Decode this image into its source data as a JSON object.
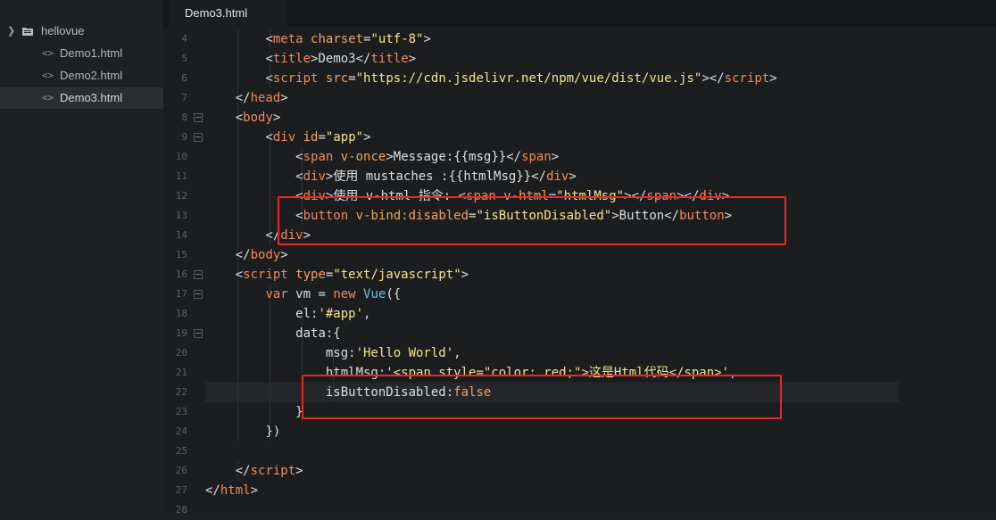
{
  "sidebar": {
    "folder": "hellovue",
    "files": [
      "Demo1.html",
      "Demo2.html",
      "Demo3.html"
    ],
    "active_index": 2
  },
  "tab": {
    "title": "Demo3.html"
  },
  "icons": {
    "folder": "folder-icon",
    "file": "code-file-icon",
    "fold": "fold-toggle-icon"
  },
  "colors": {
    "annotation": "#e8262c",
    "tag": "#f08a5d",
    "string": "#f5e48a",
    "attribute": "#f3a35c",
    "function": "#63c1e8"
  },
  "lines": [
    {
      "n": "4",
      "fold": false,
      "tokens": [
        [
          "sp",
          "        "
        ],
        [
          "pun",
          "<"
        ],
        [
          "tag",
          "meta"
        ],
        [
          "sp",
          " "
        ],
        [
          "attr",
          "charset"
        ],
        [
          "pun",
          "="
        ],
        [
          "str",
          "\"utf-8\""
        ],
        [
          "pun",
          ">"
        ]
      ]
    },
    {
      "n": "5",
      "fold": false,
      "tokens": [
        [
          "sp",
          "        "
        ],
        [
          "pun",
          "<"
        ],
        [
          "tag",
          "title"
        ],
        [
          "pun",
          ">"
        ],
        [
          "txt",
          "Demo3"
        ],
        [
          "pun",
          "</"
        ],
        [
          "tag",
          "title"
        ],
        [
          "pun",
          ">"
        ]
      ]
    },
    {
      "n": "6",
      "fold": false,
      "tokens": [
        [
          "sp",
          "        "
        ],
        [
          "pun",
          "<"
        ],
        [
          "tag",
          "script"
        ],
        [
          "sp",
          " "
        ],
        [
          "attr",
          "src"
        ],
        [
          "pun",
          "="
        ],
        [
          "str",
          "\"https://cdn.jsdelivr.net/npm/vue/dist/vue.js\""
        ],
        [
          "pun",
          "></"
        ],
        [
          "tag",
          "script"
        ],
        [
          "pun",
          ">"
        ]
      ]
    },
    {
      "n": "7",
      "fold": false,
      "tokens": [
        [
          "sp",
          "    "
        ],
        [
          "pun",
          "</"
        ],
        [
          "tag",
          "head"
        ],
        [
          "pun",
          ">"
        ]
      ]
    },
    {
      "n": "8",
      "fold": true,
      "tokens": [
        [
          "sp",
          "    "
        ],
        [
          "pun",
          "<"
        ],
        [
          "tag",
          "body"
        ],
        [
          "pun",
          ">"
        ]
      ]
    },
    {
      "n": "9",
      "fold": true,
      "tokens": [
        [
          "sp",
          "        "
        ],
        [
          "pun",
          "<"
        ],
        [
          "tag",
          "div"
        ],
        [
          "sp",
          " "
        ],
        [
          "attr",
          "id"
        ],
        [
          "pun",
          "="
        ],
        [
          "str",
          "\"app\""
        ],
        [
          "pun",
          ">"
        ]
      ]
    },
    {
      "n": "10",
      "fold": false,
      "tokens": [
        [
          "sp",
          "            "
        ],
        [
          "pun",
          "<"
        ],
        [
          "tag",
          "span"
        ],
        [
          "sp",
          " "
        ],
        [
          "attr",
          "v-once"
        ],
        [
          "pun",
          ">"
        ],
        [
          "txt",
          "Message:{{msg}}"
        ],
        [
          "pun",
          "</"
        ],
        [
          "tag",
          "span"
        ],
        [
          "pun",
          ">"
        ]
      ]
    },
    {
      "n": "11",
      "fold": false,
      "tokens": [
        [
          "sp",
          "            "
        ],
        [
          "pun",
          "<"
        ],
        [
          "tag",
          "div"
        ],
        [
          "pun",
          ">"
        ],
        [
          "txt",
          "使用 mustaches :{{htmlMsg}}"
        ],
        [
          "pun",
          "</"
        ],
        [
          "tag",
          "div"
        ],
        [
          "pun",
          ">"
        ]
      ]
    },
    {
      "n": "12",
      "fold": false,
      "tokens": [
        [
          "sp",
          "            "
        ],
        [
          "pun",
          "<"
        ],
        [
          "tag",
          "div"
        ],
        [
          "pun",
          ">"
        ],
        [
          "txt",
          "使用 v-html 指令: "
        ],
        [
          "pun",
          "<"
        ],
        [
          "tag",
          "span"
        ],
        [
          "sp",
          " "
        ],
        [
          "attr",
          "v-html"
        ],
        [
          "pun",
          "="
        ],
        [
          "str",
          "\"htmlMsg\""
        ],
        [
          "pun",
          "></"
        ],
        [
          "tag",
          "span"
        ],
        [
          "pun",
          "></"
        ],
        [
          "tag",
          "div"
        ],
        [
          "pun",
          ">"
        ]
      ]
    },
    {
      "n": "13",
      "fold": false,
      "tokens": [
        [
          "sp",
          "            "
        ],
        [
          "pun",
          "<"
        ],
        [
          "tag",
          "button"
        ],
        [
          "sp",
          " "
        ],
        [
          "attr",
          "v-bind:disabled"
        ],
        [
          "pun",
          "="
        ],
        [
          "str",
          "\"isButtonDisabled\""
        ],
        [
          "pun",
          ">"
        ],
        [
          "txt",
          "Button"
        ],
        [
          "pun",
          "</"
        ],
        [
          "tag",
          "button"
        ],
        [
          "pun",
          ">"
        ]
      ]
    },
    {
      "n": "14",
      "fold": false,
      "tokens": [
        [
          "sp",
          "        "
        ],
        [
          "pun",
          "</"
        ],
        [
          "tag",
          "div"
        ],
        [
          "pun",
          ">"
        ]
      ]
    },
    {
      "n": "15",
      "fold": false,
      "tokens": [
        [
          "sp",
          "    "
        ],
        [
          "pun",
          "</"
        ],
        [
          "tag",
          "body"
        ],
        [
          "pun",
          ">"
        ]
      ]
    },
    {
      "n": "16",
      "fold": true,
      "tokens": [
        [
          "sp",
          "    "
        ],
        [
          "pun",
          "<"
        ],
        [
          "tag",
          "script"
        ],
        [
          "sp",
          " "
        ],
        [
          "attr",
          "type"
        ],
        [
          "pun",
          "="
        ],
        [
          "str",
          "\"text/javascript\""
        ],
        [
          "pun",
          ">"
        ]
      ]
    },
    {
      "n": "17",
      "fold": true,
      "tokens": [
        [
          "sp",
          "        "
        ],
        [
          "kw",
          "var"
        ],
        [
          "txt",
          " vm = "
        ],
        [
          "kw",
          "new"
        ],
        [
          "sp",
          " "
        ],
        [
          "fn",
          "Vue"
        ],
        [
          "pun",
          "({"
        ]
      ]
    },
    {
      "n": "18",
      "fold": false,
      "tokens": [
        [
          "sp",
          "            "
        ],
        [
          "txt",
          "el:"
        ],
        [
          "sstr",
          "'#app'"
        ],
        [
          "pun",
          ","
        ]
      ]
    },
    {
      "n": "19",
      "fold": true,
      "tokens": [
        [
          "sp",
          "            "
        ],
        [
          "txt",
          "data:{"
        ]
      ]
    },
    {
      "n": "20",
      "fold": false,
      "tokens": [
        [
          "sp",
          "                "
        ],
        [
          "txt",
          "msg:"
        ],
        [
          "sstr",
          "'Hello World'"
        ],
        [
          "pun",
          ","
        ]
      ]
    },
    {
      "n": "21",
      "fold": false,
      "tokens": [
        [
          "sp",
          "                "
        ],
        [
          "txt",
          "htmlMsg:"
        ],
        [
          "sstr",
          "'<span style=\"color: red;\">这是Html代码</span>'"
        ],
        [
          "pun",
          ","
        ]
      ]
    },
    {
      "n": "22",
      "fold": false,
      "tokens": [
        [
          "sp",
          "                "
        ],
        [
          "txt",
          "isButtonDisabled:"
        ],
        [
          "bool",
          "false"
        ]
      ]
    },
    {
      "n": "23",
      "fold": false,
      "tokens": [
        [
          "sp",
          "            "
        ],
        [
          "txt",
          "}"
        ]
      ]
    },
    {
      "n": "24",
      "fold": false,
      "tokens": [
        [
          "sp",
          "        "
        ],
        [
          "txt",
          "})"
        ]
      ]
    },
    {
      "n": "25",
      "fold": false,
      "tokens": []
    },
    {
      "n": "26",
      "fold": false,
      "tokens": [
        [
          "sp",
          "    "
        ],
        [
          "pun",
          "</"
        ],
        [
          "tag",
          "script"
        ],
        [
          "pun",
          ">"
        ]
      ]
    },
    {
      "n": "27",
      "fold": false,
      "tokens": [
        [
          "pun",
          "</"
        ],
        [
          "tag",
          "html"
        ],
        [
          "pun",
          ">"
        ]
      ]
    },
    {
      "n": "28",
      "fold": false,
      "tokens": []
    }
  ],
  "current_line": "22"
}
